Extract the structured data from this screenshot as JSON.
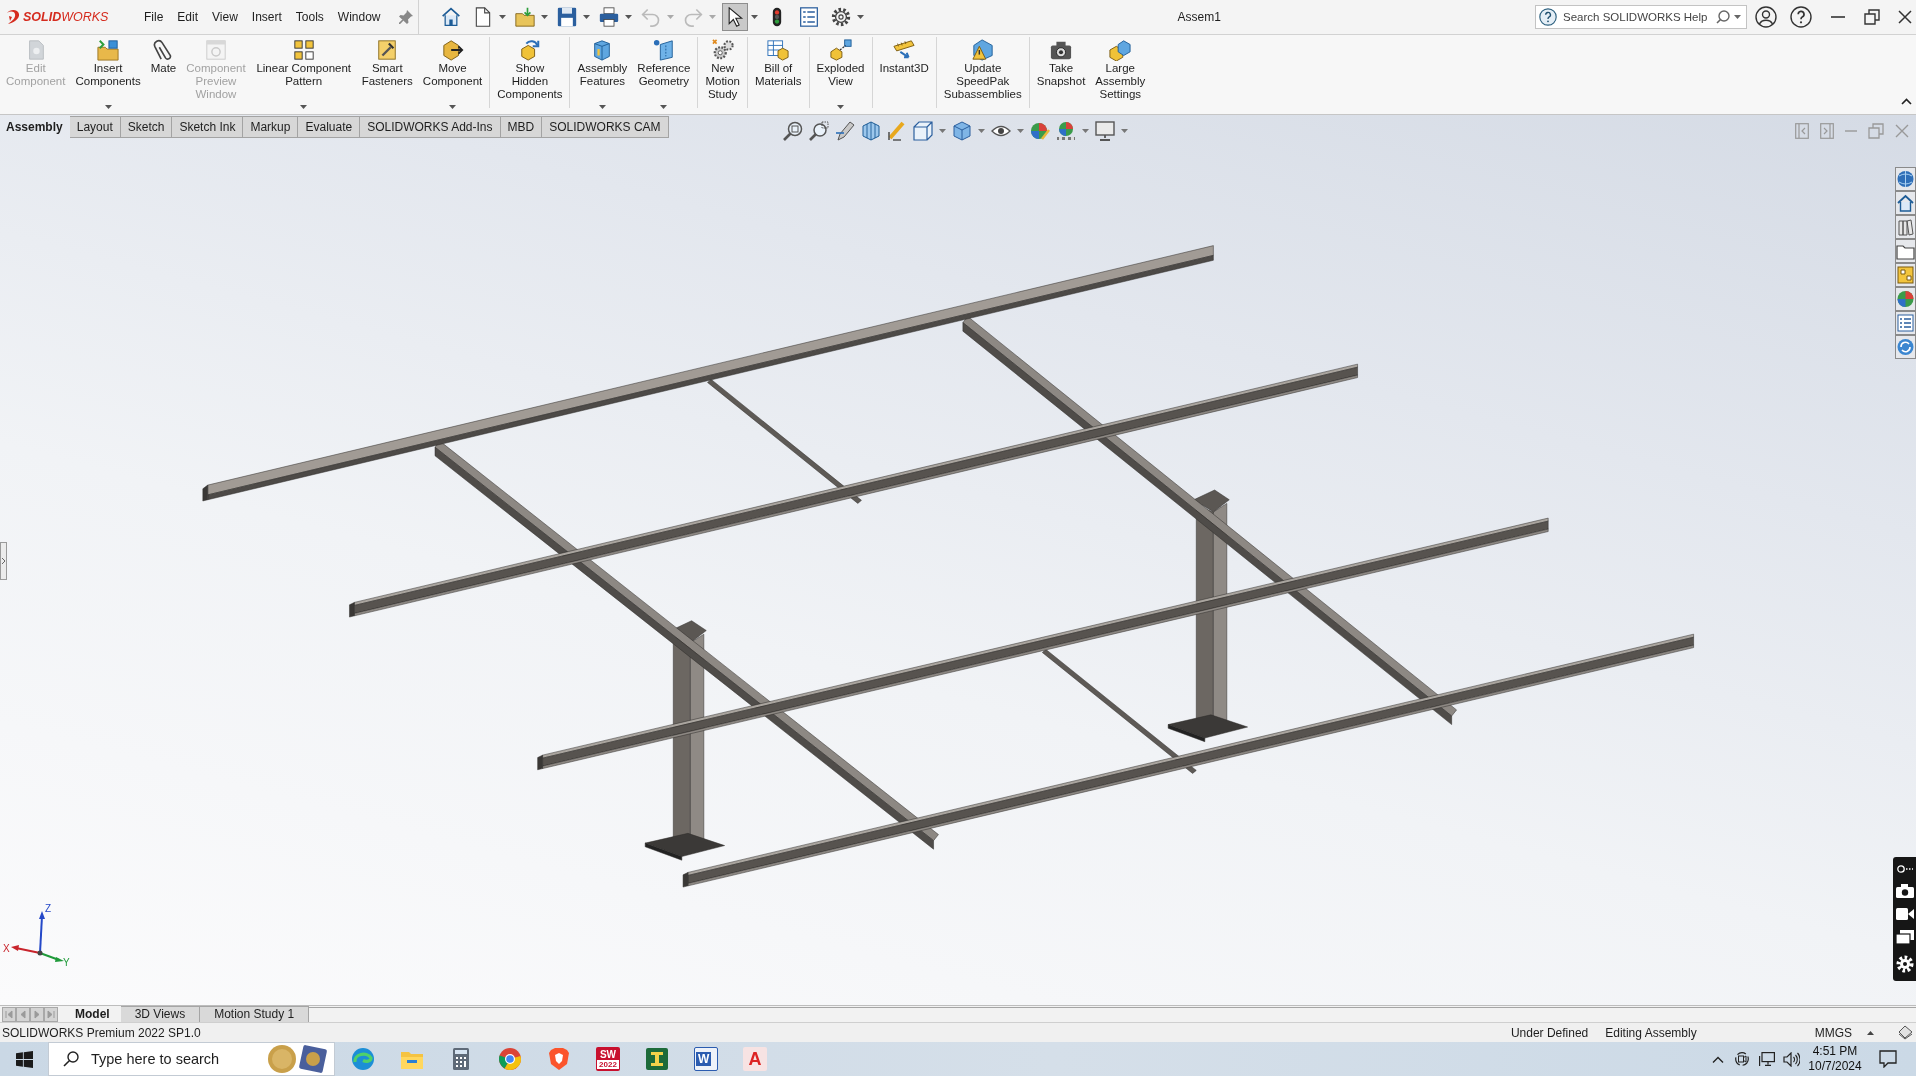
{
  "title_bar": {
    "logo": "**SOLID**WORKS",
    "menus": [
      "File",
      "Edit",
      "View",
      "Insert",
      "Tools",
      "Window"
    ],
    "quick_access": [
      {
        "has_menu": false,
        "disabled": false,
        "selected": false
      },
      {
        "has_menu": true,
        "disabled": false,
        "selected": false
      },
      {
        "has_menu": true,
        "disabled": false,
        "selected": false
      },
      {
        "has_menu": true,
        "disabled": false,
        "selected": false
      },
      {
        "has_menu": true,
        "disabled": false,
        "selected": false
      },
      {
        "has_menu": true,
        "disabled": true,
        "selected": false
      },
      {
        "has_menu": true,
        "disabled": true,
        "selected": false
      },
      {
        "has_menu": true,
        "disabled": false,
        "selected": true
      },
      {
        "has_menu": false,
        "disabled": false,
        "selected": false
      },
      {
        "has_menu": false,
        "disabled": false,
        "selected": false
      },
      {
        "has_menu": true,
        "disabled": false,
        "selected": false
      }
    ],
    "document": "Assem1",
    "help_search": {
      "placeholder": "Search SOLIDWORKS Help"
    }
  },
  "command_manager": {
    "groups": [
      {
        "buttons": [
          {
            "label": "Edit Component",
            "disabled": true,
            "has_menu": false
          },
          {
            "label": "Insert Components",
            "disabled": false,
            "has_menu": true
          },
          {
            "label": "Mate",
            "disabled": false,
            "has_menu": false
          },
          {
            "label": "Component Preview Window",
            "disabled": true,
            "has_menu": false
          },
          {
            "label": "Linear Component Pattern",
            "disabled": false,
            "has_menu": true
          },
          {
            "label": "Smart Fasteners",
            "disabled": false,
            "has_menu": false
          },
          {
            "label": "Move Component",
            "disabled": false,
            "has_menu": true
          }
        ]
      },
      {
        "buttons": [
          {
            "label": "Show Hidden Components",
            "disabled": false,
            "has_menu": false
          }
        ]
      },
      {
        "buttons": [
          {
            "label": "Assembly Features",
            "disabled": false,
            "has_menu": true
          },
          {
            "label": "Reference Geometry",
            "disabled": false,
            "has_menu": true
          }
        ]
      },
      {
        "buttons": [
          {
            "label": "New Motion Study",
            "disabled": false,
            "has_menu": false
          }
        ]
      },
      {
        "buttons": [
          {
            "label": "Bill of Materials",
            "disabled": false,
            "has_menu": false
          }
        ]
      },
      {
        "buttons": [
          {
            "label": "Exploded View",
            "disabled": false,
            "has_menu": true
          }
        ]
      },
      {
        "buttons": [
          {
            "label": "Instant3D",
            "disabled": false,
            "has_menu": false
          }
        ]
      },
      {
        "buttons": [
          {
            "label": "Update SpeedPak Subassemblies",
            "disabled": false,
            "has_menu": false
          }
        ]
      },
      {
        "buttons": [
          {
            "label": "Take Snapshot",
            "disabled": false,
            "has_menu": false
          },
          {
            "label": "Large Assembly Settings",
            "disabled": false,
            "has_menu": false
          }
        ]
      }
    ]
  },
  "tabs": [
    {
      "label": "Assembly",
      "selected": true
    },
    {
      "label": "Layout",
      "selected": false
    },
    {
      "label": "Sketch",
      "selected": false
    },
    {
      "label": "Sketch Ink",
      "selected": false
    },
    {
      "label": "Markup",
      "selected": false
    },
    {
      "label": "Evaluate",
      "selected": false
    },
    {
      "label": "SOLIDWORKS Add-Ins",
      "selected": false
    },
    {
      "label": "MBD",
      "selected": false
    },
    {
      "label": "SOLIDWORKS CAM",
      "selected": false
    }
  ],
  "view_toolbar": [
    {
      "has_menu": false
    },
    {
      "has_menu": false
    },
    {
      "has_menu": false
    },
    {
      "has_menu": false
    },
    {
      "has_menu": false
    },
    {
      "has_menu": true
    },
    {
      "has_menu": true
    },
    {
      "has_menu": true
    },
    {
      "has_menu": false
    },
    {
      "has_menu": true
    },
    {
      "has_menu": true
    }
  ],
  "axis_triad": {
    "labels": [
      "Z",
      "X",
      "Y"
    ]
  },
  "model_tabs": [
    {
      "label": "Model",
      "selected": true
    },
    {
      "label": "3D Views",
      "selected": false
    },
    {
      "label": "Motion Study 1",
      "selected": false
    }
  ],
  "status_bar": {
    "product": "SOLIDWORKS Premium 2022 SP1.0",
    "state": "Under Defined",
    "mode": "Editing Assembly",
    "units": "MMGS"
  },
  "taskbar": {
    "search": {
      "placeholder": "Type here to search"
    },
    "apps": [
      {
        "kind": "swirl"
      },
      {
        "kind": "folder"
      },
      {
        "kind": "calculator"
      },
      {
        "kind": "ring"
      },
      {
        "kind": "shield"
      },
      {
        "kind": "tile",
        "glyph": "SW",
        "caption": "2022"
      },
      {
        "kind": "beam"
      },
      {
        "kind": "page",
        "glyph": "W"
      },
      {
        "kind": "letter",
        "glyph": "A"
      }
    ],
    "time": "4:51 PM",
    "date": "10/7/2024"
  }
}
